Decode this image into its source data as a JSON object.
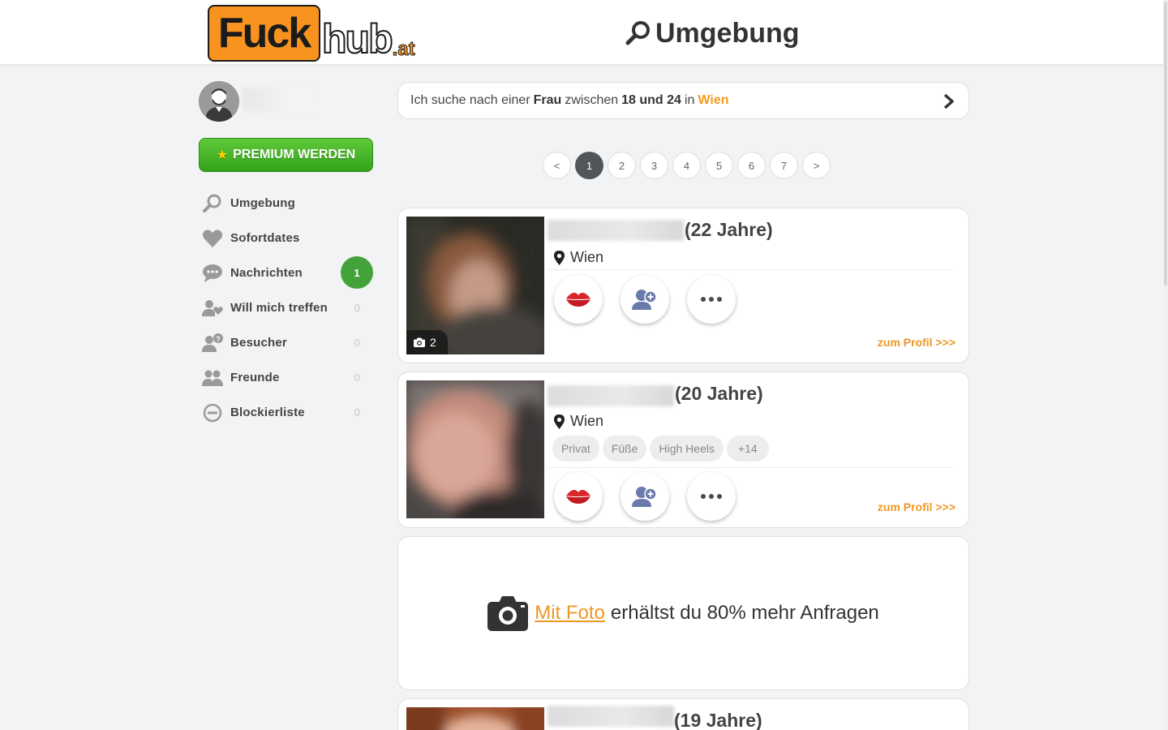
{
  "header": {
    "logo": {
      "part1": "Fuck",
      "part2": "hub",
      "part3": ".at"
    },
    "title": "Umgebung"
  },
  "sidebar": {
    "premium_label": "PREMIUM WERDEN",
    "items": [
      {
        "label": "Umgebung",
        "icon": "search-icon",
        "count": ""
      },
      {
        "label": "Sofortdates",
        "icon": "heart-icon",
        "count": ""
      },
      {
        "label": "Nachrichten",
        "icon": "chat-icon",
        "badge": "1"
      },
      {
        "label": "Will mich treffen",
        "icon": "user-heart-icon",
        "count": "0"
      },
      {
        "label": "Besucher",
        "icon": "user-question-icon",
        "count": "0"
      },
      {
        "label": "Freunde",
        "icon": "users-icon",
        "count": "0"
      },
      {
        "label": "Blockierliste",
        "icon": "block-icon",
        "count": "0"
      }
    ]
  },
  "search": {
    "prefix": "Ich suche nach einer",
    "gender": "Frau",
    "between": "zwischen",
    "age_range": "18 und 24",
    "in": "in",
    "city": "Wien"
  },
  "pagination": {
    "prev": "<",
    "pages": [
      "1",
      "2",
      "3",
      "4",
      "5",
      "6",
      "7"
    ],
    "active": "1",
    "next": ">"
  },
  "profiles": [
    {
      "age": "(22 Jahre)",
      "location": "Wien",
      "photo_count": "2",
      "tags": [],
      "link": "zum Profil >>>"
    },
    {
      "age": "(20 Jahre)",
      "location": "Wien",
      "tags": [
        "Privat",
        "Füße",
        "High Heels",
        "+14"
      ],
      "link": "zum Profil >>>"
    },
    {
      "age": "(19 Jahre)"
    }
  ],
  "promo": {
    "link_text": "Mit Foto",
    "rest_text": "erhältst du 80% mehr Anfragen"
  },
  "colors": {
    "brand_orange": "#f7931e",
    "accent_orange": "#ee9724",
    "premium_green": "#43a33a",
    "kiss_red": "#d9262c",
    "friend_blue": "#6a7bab"
  }
}
